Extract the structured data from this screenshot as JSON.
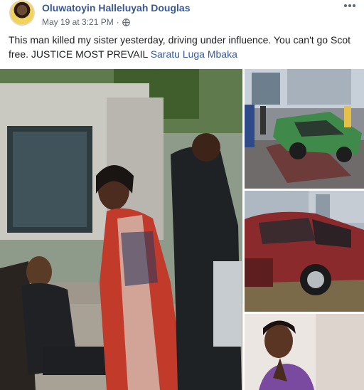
{
  "post": {
    "author": "Oluwatoyin Halleluyah Douglas",
    "timestamp": "May 19 at 3:21 PM",
    "separator": "·",
    "privacy_icon": "globe-icon",
    "menu_icon": "more-options-icon",
    "text_main": "This man killed my sister yesterday, driving under influence. You can't go Scot free. JUSTICE MOST PREVAIL",
    "tagged_person": "Saratu Luga Mbaka"
  },
  "photos": [
    {
      "icon": "photo-roadside-scene"
    },
    {
      "icon": "photo-wrecked-green-car"
    },
    {
      "icon": "photo-damaged-red-car"
    },
    {
      "icon": "photo-portrait-woman"
    }
  ],
  "colors": {
    "link": "#385898",
    "text": "#1c1e21",
    "meta": "#606770"
  }
}
